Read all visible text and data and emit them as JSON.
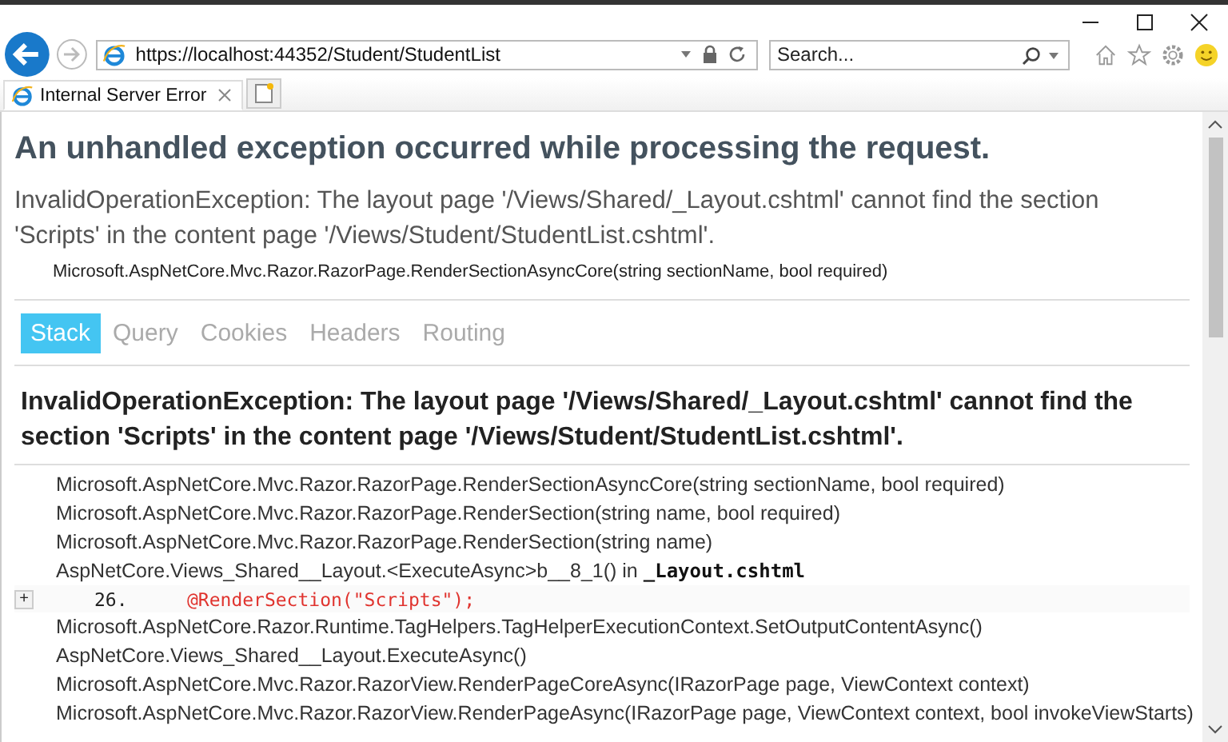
{
  "browser": {
    "address": "https://localhost:44352/Student/StudentList",
    "search": {
      "placeholder": "Search..."
    },
    "tabs": [
      {
        "title": "Internal Server Error",
        "selected": true
      }
    ]
  },
  "page": {
    "title": "An unhandled exception occurred while processing the request.",
    "message": "InvalidOperationException: The layout page '/Views/Shared/_Layout.cshtml' cannot find the section 'Scripts' in the content page '/Views/Student/StudentList.cshtml'.",
    "location": "Microsoft.AspNetCore.Mvc.Razor.RazorPage.RenderSectionAsyncCore(string sectionName, bool required)",
    "tabs": [
      {
        "label": "Stack",
        "selected": true
      },
      {
        "label": "Query",
        "selected": false
      },
      {
        "label": "Cookies",
        "selected": false
      },
      {
        "label": "Headers",
        "selected": false
      },
      {
        "label": "Routing",
        "selected": false
      }
    ],
    "exception_heading": "InvalidOperationException: The layout page '/Views/Shared/_Layout.cshtml' cannot find the section 'Scripts' in the content page '/Views/Student/StudentList.cshtml'.",
    "stack": [
      {
        "kind": "frame",
        "text": "Microsoft.AspNetCore.Mvc.Razor.RazorPage.RenderSectionAsyncCore(string sectionName, bool required)"
      },
      {
        "kind": "frame",
        "text": "Microsoft.AspNetCore.Mvc.Razor.RazorPage.RenderSection(string name, bool required)"
      },
      {
        "kind": "frame",
        "text": "Microsoft.AspNetCore.Mvc.Razor.RazorPage.RenderSection(string name)"
      },
      {
        "kind": "frame",
        "text": "AspNetCore.Views_Shared__Layout.<ExecuteAsync>b__8_1() in",
        "file": "_Layout.cshtml"
      },
      {
        "kind": "source",
        "toggle": "+",
        "line_number": "26.",
        "code": "@RenderSection(\"Scripts\");"
      },
      {
        "kind": "frame",
        "text": "Microsoft.AspNetCore.Razor.Runtime.TagHelpers.TagHelperExecutionContext.SetOutputContentAsync()"
      },
      {
        "kind": "frame",
        "text": "AspNetCore.Views_Shared__Layout.ExecuteAsync()"
      },
      {
        "kind": "frame",
        "text": "Microsoft.AspNetCore.Mvc.Razor.RazorView.RenderPageCoreAsync(IRazorPage page, ViewContext context)"
      },
      {
        "kind": "frame",
        "text": "Microsoft.AspNetCore.Mvc.Razor.RazorView.RenderPageAsync(IRazorPage page, ViewContext context, bool invokeViewStarts)"
      }
    ]
  }
}
